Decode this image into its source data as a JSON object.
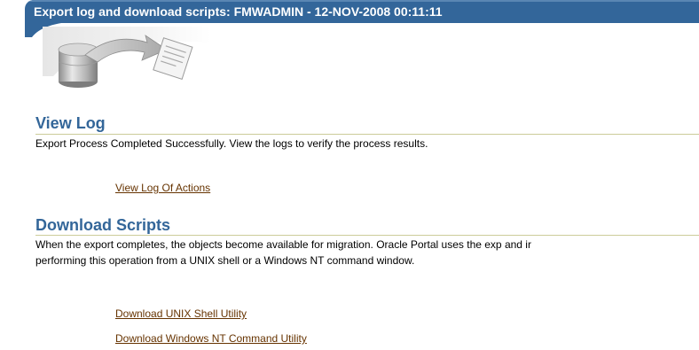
{
  "header": {
    "title": "Export log and download scripts: FMWADMIN - 12-NOV-2008 00:11:11",
    "graphic_icon": "export-database-icon"
  },
  "view_log": {
    "title": "View Log",
    "description": "Export Process Completed Successfully. View the logs to verify the process results.",
    "link_label": "View Log Of Actions"
  },
  "download_scripts": {
    "title": "Download Scripts",
    "description_line1": "When the export completes, the objects become available for migration. Oracle Portal uses the exp and ir",
    "description_line2": "performing this operation from a UNIX shell or a Windows NT command window.",
    "links": [
      "Download UNIX Shell Utility",
      "Download Windows NT Command Utility"
    ]
  },
  "colors": {
    "header_bg": "#33669a",
    "section_title": "#336699",
    "link": "#663300",
    "rule": "#cccc99"
  }
}
